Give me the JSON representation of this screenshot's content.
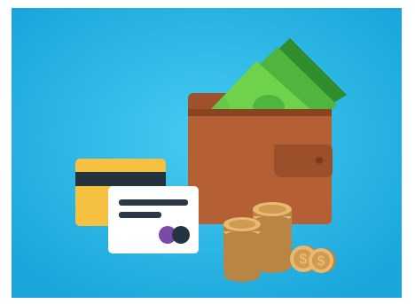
{
  "scene": {
    "subject": "wallet-with-cash-cards-and-coins",
    "colors": {
      "background_center": "#45ccf2",
      "background_edge": "#1aa6db",
      "wallet_main": "#b45f34",
      "wallet_dark": "#8a4422",
      "wallet_strap": "#9b4f2b",
      "cash_light": "#6ed34b",
      "cash_mid": "#4fb53c",
      "cash_dark": "#2f8d2e",
      "card_yellow": "#f6c140",
      "card_stripe": "#24323f",
      "card_white": "#ffffff",
      "card_text_bar": "#2b3848",
      "card_circle_purple": "#7b4aa6",
      "card_circle_dark": "#263340",
      "coin_light": "#e8b96f",
      "coin_mid": "#cf9a52",
      "coin_dark": "#b88542"
    }
  }
}
